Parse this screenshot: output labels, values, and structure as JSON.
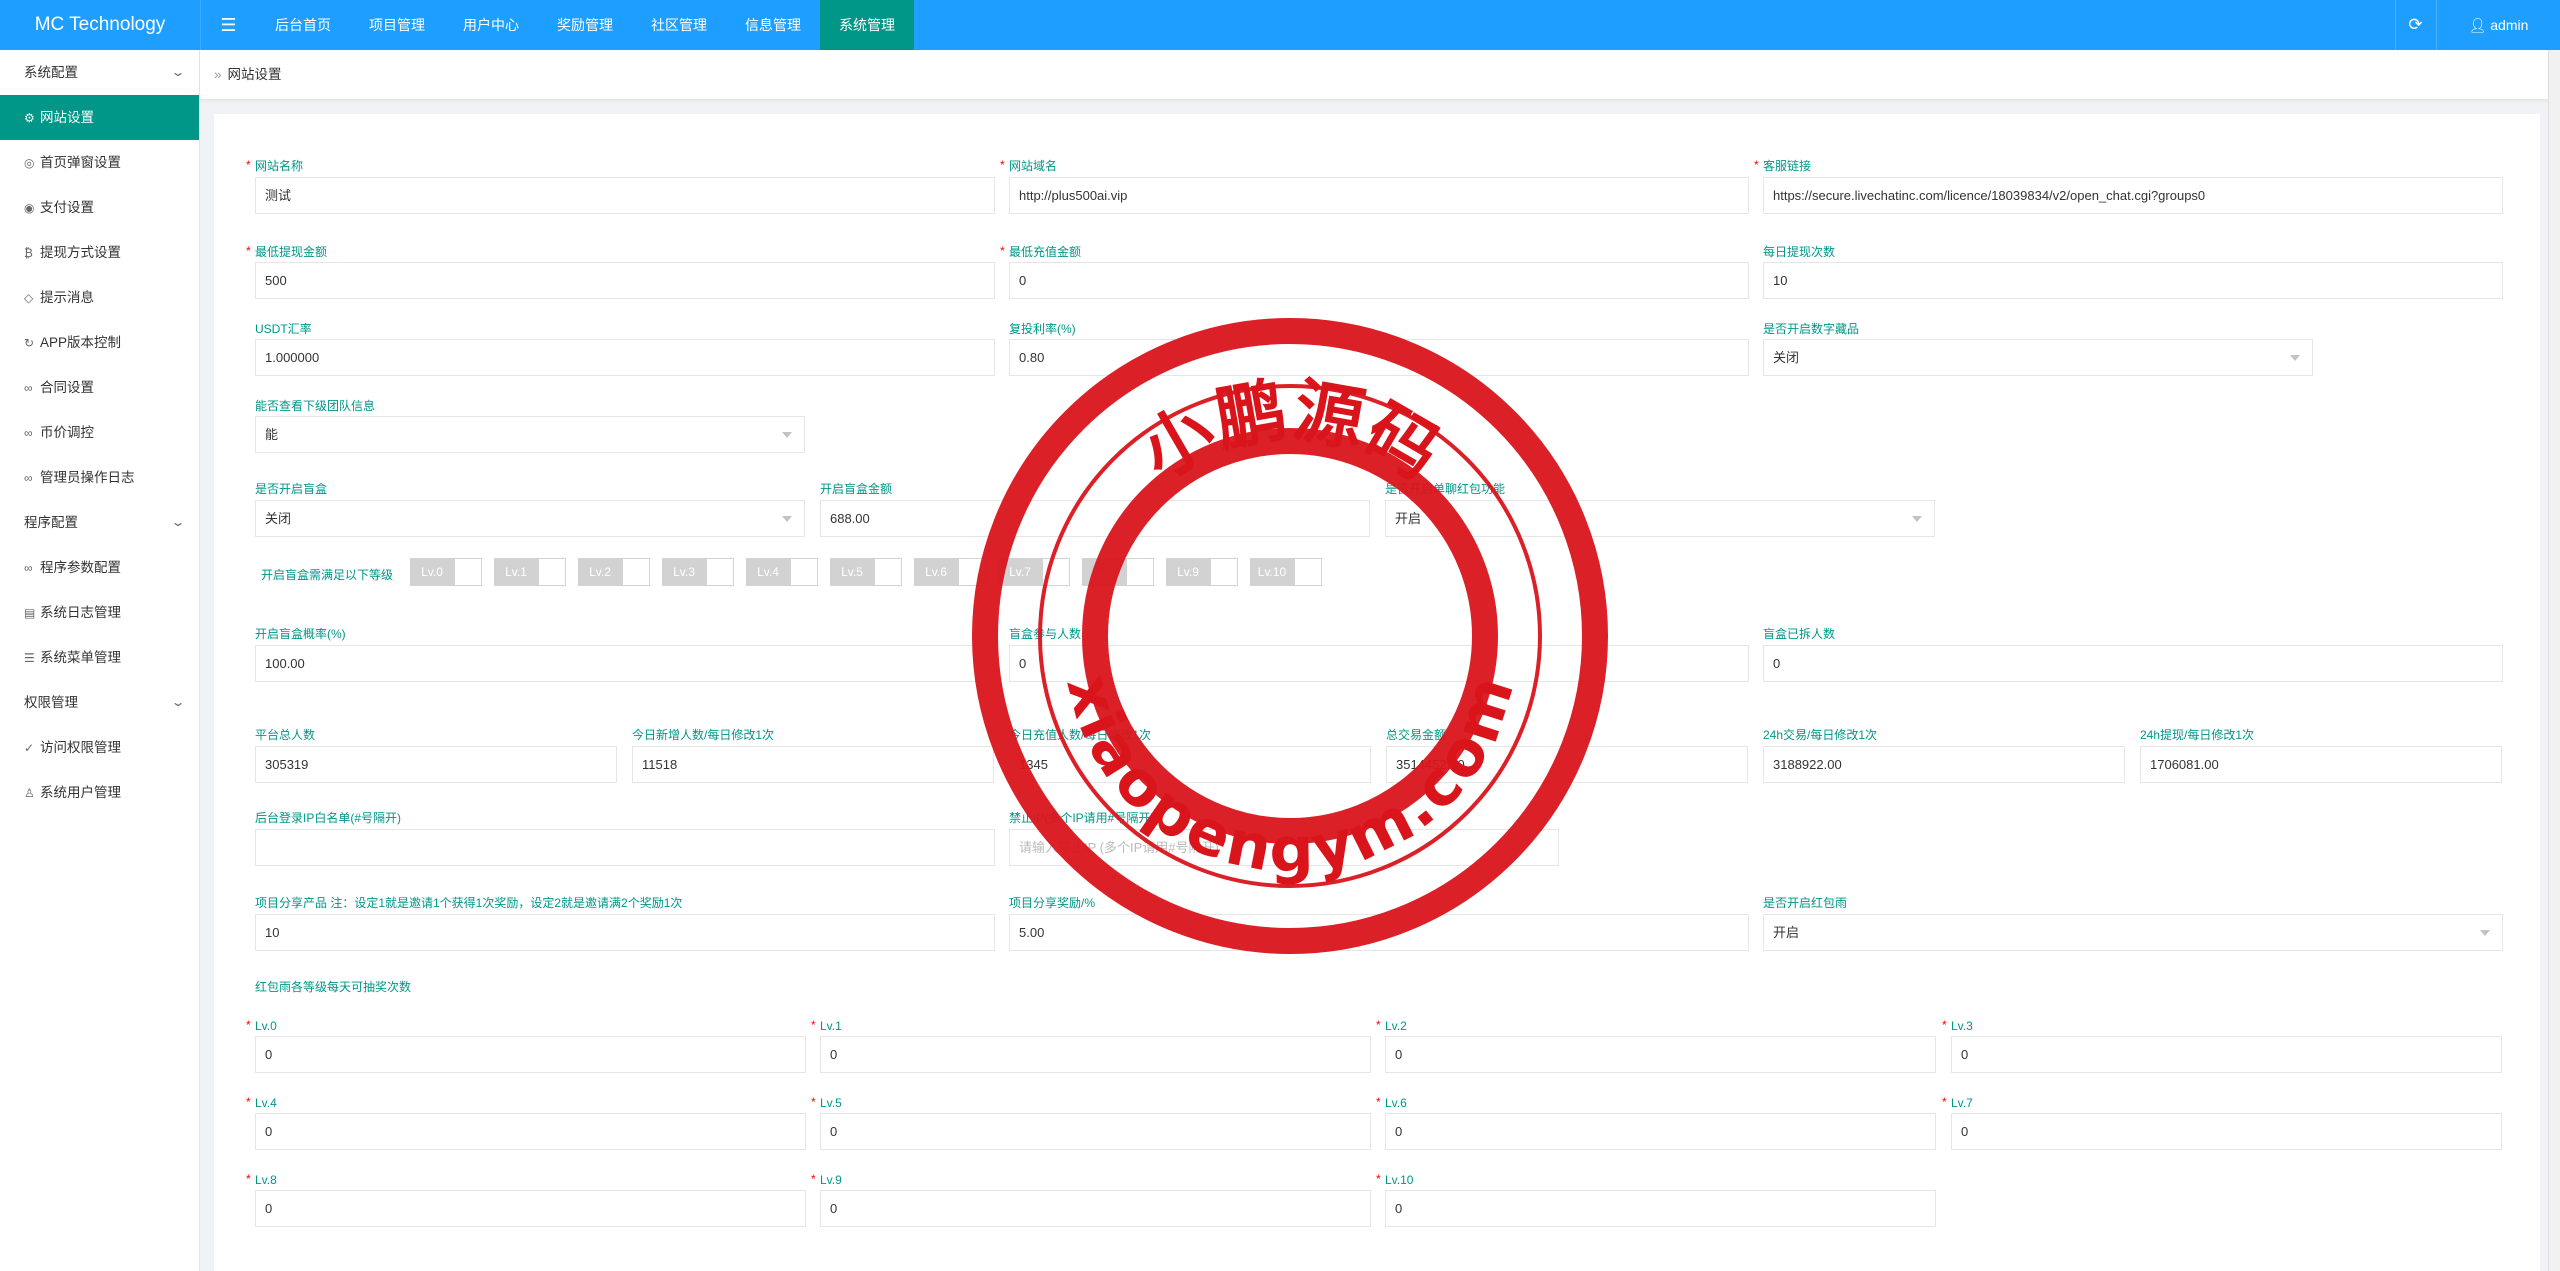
{
  "app": {
    "brand": "MC Technology"
  },
  "topnav": {
    "menu_icon": "menu-icon",
    "items": [
      "后台首页",
      "项目管理",
      "用户中心",
      "奖励管理",
      "社区管理",
      "信息管理",
      "系统管理"
    ],
    "active": "系统管理",
    "refresh_icon": "refresh-icon",
    "user": "admin"
  },
  "sidebar": {
    "group1": "系统配置",
    "items1": [
      "网站设置",
      "首页弹窗设置",
      "支付设置",
      "提现方式设置",
      "提示消息",
      "APP版本控制",
      "合同设置",
      "币价调控",
      "管理员操作日志"
    ],
    "group2": "程序配置",
    "items2": [
      "程序参数配置",
      "系统日志管理",
      "系统菜单管理"
    ],
    "group3": "权限管理",
    "items3": [
      "访问权限管理",
      "系统用户管理"
    ]
  },
  "breadcrumb": "网站设置",
  "form": {
    "site_name": {
      "label": "网站名称",
      "value": "测试"
    },
    "site_domain": {
      "label": "网站域名",
      "value": "http://plus500ai.vip"
    },
    "service_link": {
      "label": "客服链接",
      "value": "https://secure.livechatinc.com/licence/18039834/v2/open_chat.cgi?groups0"
    },
    "min_withdraw": {
      "label": "最低提现金额",
      "value": "500"
    },
    "min_recharge": {
      "label": "最低充值金额",
      "value": "0"
    },
    "daily_withdraw": {
      "label": "每日提现次数",
      "value": "10"
    },
    "usdt_rate": {
      "label": "USDT汇率",
      "value": "1.000000"
    },
    "reinvest_rate": {
      "label": "复投利率(%)",
      "value": "0.80"
    },
    "digital_collection": {
      "label": "是否开启数字藏品",
      "value": "关闭"
    },
    "view_team": {
      "label": "能否查看下级团队信息",
      "value": "能"
    },
    "blindbox_open": {
      "label": "是否开启盲盒",
      "value": "关闭"
    },
    "blindbox_amount": {
      "label": "开启盲盒金额",
      "value": "688.00"
    },
    "red_packet_single": {
      "label": "是否开启单聊红包功能",
      "value": "开启"
    },
    "blindbox_levels": {
      "label": "开启盲盒需满足以下等级",
      "levels": [
        "Lv.0",
        "Lv.1",
        "Lv.2",
        "Lv.3",
        "Lv.4",
        "Lv.5",
        "Lv.6",
        "Lv.7",
        "Lv.8",
        "Lv.9",
        "Lv.10"
      ]
    },
    "blindbox_prob": {
      "label": "开启盲盒概率(%)",
      "value": "100.00"
    },
    "blindbox_join": {
      "label": "盲盒参与人数",
      "value": "0"
    },
    "blindbox_opened": {
      "label": "盲盒已拆人数",
      "value": "0"
    },
    "platform_users": {
      "label": "平台总人数",
      "value": "305319"
    },
    "today_new": {
      "label": "今日新增人数/每日修改1次",
      "value": "11518"
    },
    "today_recharge": {
      "label": "今日充值人数/每日修改1次",
      "value": "1345"
    },
    "total_trade": {
      "label": "总交易金额",
      "value": "3514452.00"
    },
    "trade_24h": {
      "label": "24h交易/每日修改1次",
      "value": "3188922.00"
    },
    "withdraw_24h": {
      "label": "24h提现/每日修改1次",
      "value": "1706081.00"
    },
    "ip_whitelist": {
      "label": "后台登录IP白名单(#号隔开)",
      "value": ""
    },
    "ip_blacklist": {
      "label": "禁止IP(多个IP请用#号隔开)",
      "placeholder": "请输入禁止IP (多个IP请用#号隔开)"
    },
    "share_product": {
      "label": "项目分享产品 注：设定1就是邀请1个获得1次奖励，设定2就是邀请满2个奖励1次",
      "value": "10"
    },
    "share_reward": {
      "label": "项目分享奖励/%",
      "value": "5.00"
    },
    "red_packet_rain": {
      "label": "是否开启红包雨",
      "value": "开启"
    },
    "rain_levels_title": "红包雨各等级每天可抽奖次数",
    "rain_levels": [
      {
        "label": "Lv.0",
        "value": "0"
      },
      {
        "label": "Lv.1",
        "value": "0"
      },
      {
        "label": "Lv.2",
        "value": "0"
      },
      {
        "label": "Lv.3",
        "value": "0"
      },
      {
        "label": "Lv.4",
        "value": "0"
      },
      {
        "label": "Lv.5",
        "value": "0"
      },
      {
        "label": "Lv.6",
        "value": "0"
      },
      {
        "label": "Lv.7",
        "value": "0"
      },
      {
        "label": "Lv.8",
        "value": "0"
      },
      {
        "label": "Lv.9",
        "value": "0"
      },
      {
        "label": "Lv.10",
        "value": "0"
      }
    ]
  },
  "watermark": {
    "top_text": "小鹏源码",
    "bottom_text": "xiaopengym.com",
    "color": "#d9141b"
  }
}
